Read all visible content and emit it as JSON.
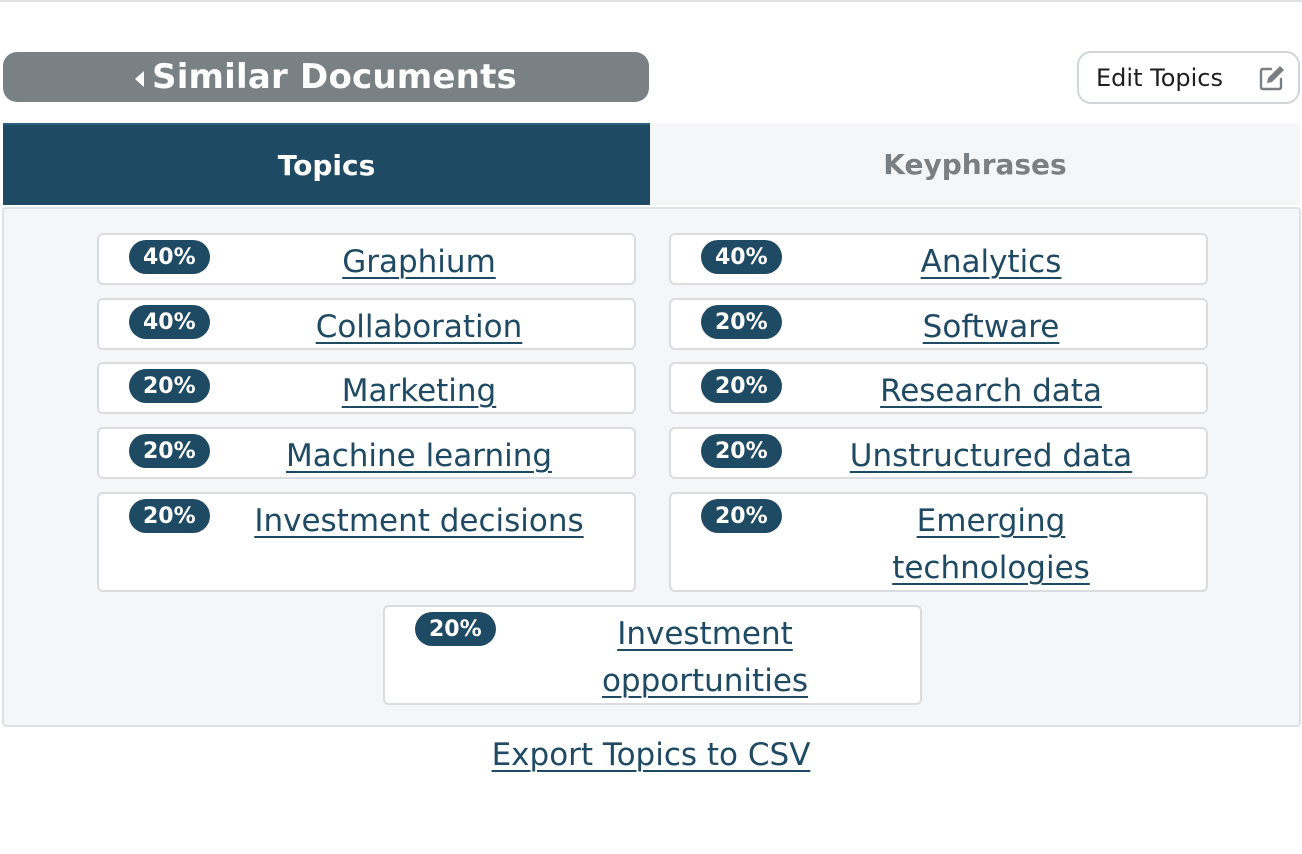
{
  "header": {
    "similar_documents_label": "Similar Documents",
    "edit_topics_label": "Edit Topics"
  },
  "tabs": [
    {
      "label": "Topics",
      "active": true
    },
    {
      "label": "Keyphrases",
      "active": false
    }
  ],
  "topics": [
    {
      "percent": "40%",
      "label": "Graphium"
    },
    {
      "percent": "40%",
      "label": "Analytics"
    },
    {
      "percent": "40%",
      "label": "Collaboration"
    },
    {
      "percent": "20%",
      "label": "Software"
    },
    {
      "percent": "20%",
      "label": "Marketing"
    },
    {
      "percent": "20%",
      "label": "Research data"
    },
    {
      "percent": "20%",
      "label": "Machine learning"
    },
    {
      "percent": "20%",
      "label": "Unstructured data"
    },
    {
      "percent": "20%",
      "label": "Investment decisions"
    },
    {
      "percent": "20%",
      "label": "Emerging technologies"
    },
    {
      "percent": "20%",
      "label": "Investment opportunities"
    }
  ],
  "footer": {
    "export_label": "Export Topics to CSV"
  },
  "colors": {
    "accent": "#1f4a63",
    "gray_button": "#7a8184",
    "panel_bg": "#f5f6f8"
  }
}
